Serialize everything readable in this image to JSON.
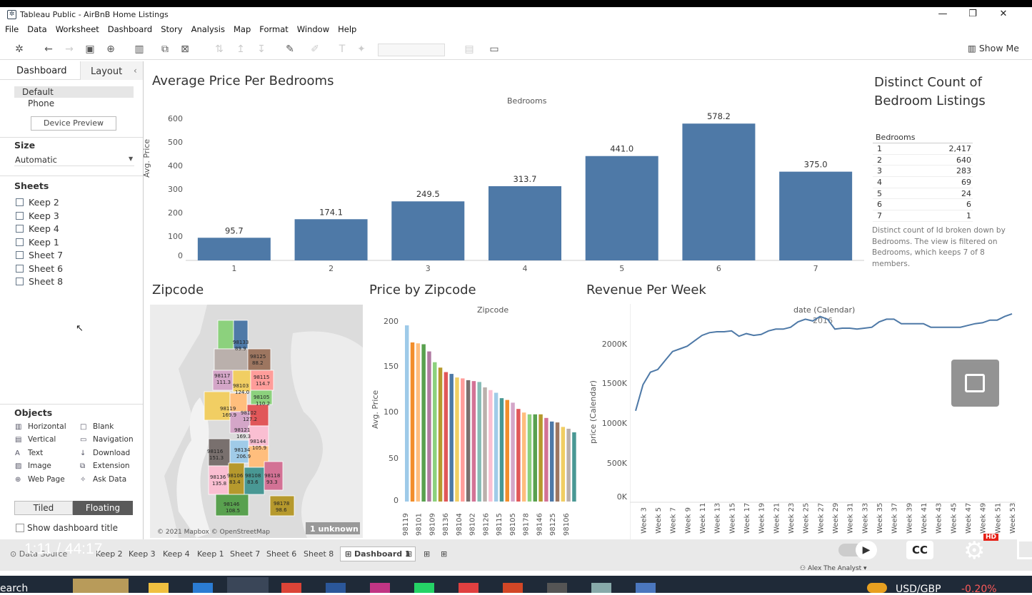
{
  "window": {
    "title": "Tableau Public - AirBnB Home Listings"
  },
  "menu": [
    "File",
    "Data",
    "Worksheet",
    "Dashboard",
    "Story",
    "Analysis",
    "Map",
    "Format",
    "Window",
    "Help"
  ],
  "toolbar": {
    "show_me": "Show Me"
  },
  "left_pane": {
    "tabs": {
      "dashboard": "Dashboard",
      "layout": "Layout"
    },
    "device": {
      "default": "Default",
      "phone": "Phone",
      "preview": "Device Preview"
    },
    "size": {
      "title": "Size",
      "value": "Automatic"
    },
    "sheets_title": "Sheets",
    "sheets": [
      "Keep 2",
      "Keep 3",
      "Keep 4",
      "Keep 1",
      "Sheet 7",
      "Sheet 6",
      "Sheet 8"
    ],
    "objects_title": "Objects",
    "objects_left": [
      "Horizontal",
      "Vertical",
      "Text",
      "Image",
      "Web Page"
    ],
    "objects_right": [
      "Blank",
      "Navigation",
      "Download",
      "Extension",
      "Ask Data"
    ],
    "tiled": "Tiled",
    "floating": "Floating",
    "show_title": "Show dashboard title"
  },
  "bar_chart": {
    "title": "Average Price Per Bedrooms",
    "header": "Bedrooms",
    "ylabel": "Avg. Price",
    "yticks": [
      "600",
      "500",
      "400",
      "300",
      "200",
      "100",
      "0"
    ]
  },
  "count_table": {
    "title": "Distinct Count of Bedroom Listings",
    "header": "Bedrooms",
    "rows": [
      [
        "1",
        "2,417"
      ],
      [
        "2",
        "640"
      ],
      [
        "3",
        "283"
      ],
      [
        "4",
        "69"
      ],
      [
        "5",
        "24"
      ],
      [
        "6",
        "6"
      ],
      [
        "7",
        "1"
      ]
    ],
    "caption": "Distinct count of Id broken down by Bedrooms. The view is filtered on Bedrooms, which keeps 7 of 8 members."
  },
  "map": {
    "title": "Zipcode",
    "attribution": "© 2021 Mapbox © OpenStreetMap",
    "unknown": "1 unknown",
    "labels": [
      [
        "98133",
        "89.9"
      ],
      [
        "98125",
        "88.2"
      ],
      [
        "98117",
        "111.3"
      ],
      [
        "98115",
        "114.7"
      ],
      [
        "98103",
        "124.0"
      ],
      [
        "98105",
        "110.2"
      ],
      [
        "98119",
        "169.9"
      ],
      [
        "98102",
        "127.2"
      ],
      [
        "98121",
        "169.3"
      ],
      [
        "98144",
        "105.9"
      ],
      [
        "98116",
        "151.3"
      ],
      [
        "98134",
        "206.9"
      ],
      [
        "98136",
        "135.8"
      ],
      [
        "98106",
        "83.4"
      ],
      [
        "98108",
        "83.6"
      ],
      [
        "98118",
        "93.3"
      ],
      [
        "98146",
        "108.5"
      ],
      [
        "98178",
        "98.6"
      ]
    ]
  },
  "zip_chart": {
    "title": "Price by Zipcode",
    "header": "Zipcode",
    "ylabel": "Avg. Price",
    "yticks": [
      "200",
      "150",
      "100",
      "50",
      "0"
    ],
    "xtick_labels": [
      "98119",
      "98101",
      "98109",
      "98136",
      "98104",
      "98102",
      "98126",
      "98115",
      "98105",
      "98178",
      "98146",
      "98125",
      "98106"
    ]
  },
  "line_chart": {
    "title": "Revenue Per Week",
    "header": "date (Calendar)",
    "subheader": "2016",
    "ylabel": "price (Calendar)",
    "yticks": [
      "2000K",
      "1500K",
      "1000K",
      "500K",
      "0K"
    ],
    "xtick_labels": [
      "Week 3",
      "Week 5",
      "Week 7",
      "Week 9",
      "Week 11",
      "Week 13",
      "Week 15",
      "Week 17",
      "Week 19",
      "Week 21",
      "Week 23",
      "Week 25",
      "Week 27",
      "Week 29",
      "Week 31",
      "Week 33",
      "Week 35",
      "Week 37",
      "Week 39",
      "Week 41",
      "Week 43",
      "Week 45",
      "Week 47",
      "Week 49",
      "Week 51",
      "Week 53"
    ]
  },
  "status_tabs": [
    "Data Source",
    "Keep 2",
    "Keep 3",
    "Keep 4",
    "Keep 1",
    "Sheet 7",
    "Sheet 6",
    "Sheet 8",
    "Dashboard 1"
  ],
  "status_user": "Alex The Analyst",
  "video": {
    "time": "1:11 / 44:17",
    "hd": "HD"
  },
  "taskbar": {
    "search": "earch",
    "currency": "USD/GBP",
    "change": "-0.20%"
  },
  "chart_data": [
    {
      "type": "bar",
      "title": "Average Price Per Bedrooms",
      "xlabel": "Bedrooms",
      "ylabel": "Avg. Price",
      "categories": [
        "1",
        "2",
        "3",
        "4",
        "5",
        "6",
        "7"
      ],
      "values": [
        95.7,
        174.1,
        249.5,
        313.7,
        441.0,
        578.2,
        375.0
      ],
      "ylim": [
        0,
        600
      ],
      "color": "#4e79a7"
    },
    {
      "type": "bar",
      "title": "Price by Zipcode",
      "xlabel": "Zipcode",
      "ylabel": "Avg. Price",
      "values": [
        196,
        177,
        176,
        175,
        167,
        155,
        149,
        144,
        142,
        138,
        137,
        135,
        134,
        133,
        127,
        124,
        121,
        115,
        113,
        110,
        103,
        99,
        97,
        97,
        97,
        93,
        89,
        88,
        83,
        81,
        77
      ],
      "ylim": [
        0,
        200
      ],
      "colors": [
        "#9ecae9",
        "#f28e2b",
        "#ffbe7d",
        "#59a14f",
        "#b07aa1",
        "#8cd17d",
        "#b6992d",
        "#e15759",
        "#4e79a7",
        "#f1ce63",
        "#ff9d9a",
        "#79706e",
        "#d37295",
        "#86bcb6",
        "#bab0ac",
        "#fabfd2",
        "#a0cbe8",
        "#499894",
        "#f28e2b",
        "#d4a6c8",
        "#e15759",
        "#ffbe7d",
        "#8cd17d",
        "#59a14f",
        "#b6992d",
        "#d37295",
        "#4e79a7",
        "#9d7660",
        "#f1ce63",
        "#bab0ac",
        "#499894"
      ]
    },
    {
      "type": "line",
      "title": "Revenue Per Week",
      "xlabel": "date (Calendar)",
      "ylabel": "price (Calendar)",
      "x": [
        "Week 2",
        "Week 3",
        "Week 4",
        "Week 5",
        "Week 6",
        "Week 7",
        "Week 8",
        "Week 9",
        "Week 10",
        "Week 11",
        "Week 12",
        "Week 13",
        "Week 14",
        "Week 15",
        "Week 16",
        "Week 17",
        "Week 18",
        "Week 19",
        "Week 20",
        "Week 21",
        "Week 22",
        "Week 23",
        "Week 24",
        "Week 25",
        "Week 26",
        "Week 27",
        "Week 28",
        "Week 29",
        "Week 30",
        "Week 31",
        "Week 32",
        "Week 33",
        "Week 34",
        "Week 35",
        "Week 36",
        "Week 37",
        "Week 38",
        "Week 39",
        "Week 40",
        "Week 41",
        "Week 42",
        "Week 43",
        "Week 44",
        "Week 45",
        "Week 46",
        "Week 47",
        "Week 48",
        "Week 49",
        "Week 50",
        "Week 51",
        "Week 52",
        "Week 53"
      ],
      "values": [
        1010,
        1300,
        1440,
        1470,
        1570,
        1670,
        1700,
        1730,
        1790,
        1850,
        1880,
        1890,
        1890,
        1900,
        1840,
        1870,
        1850,
        1860,
        1900,
        1920,
        1920,
        1940,
        2000,
        2030,
        2010,
        2060,
        2030,
        1920,
        1930,
        1930,
        1920,
        1930,
        1940,
        2000,
        2030,
        2030,
        1980,
        1980,
        1980,
        1980,
        1940,
        1940,
        1940,
        1940,
        1940,
        1960,
        1980,
        1990,
        2020,
        2020,
        2060,
        2090
      ],
      "ylim": [
        0,
        2200
      ]
    }
  ]
}
